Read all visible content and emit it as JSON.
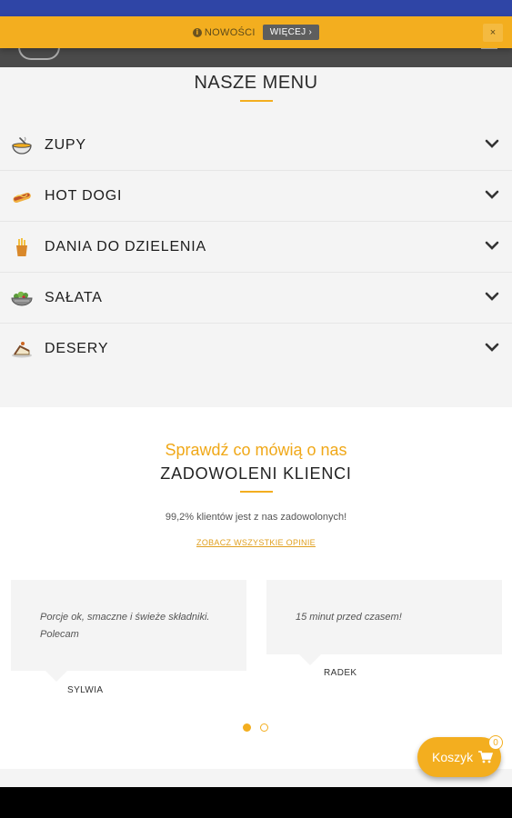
{
  "news_bar": {
    "label": "NOWOŚCI",
    "more_button": "WIĘCEJ ›",
    "close": "×",
    "info_icon_glyph": "i"
  },
  "menu": {
    "title": "NASZE MENU",
    "categories": [
      {
        "label": "ZUPY",
        "icon": "soup-bowl-icon"
      },
      {
        "label": "HOT DOGI",
        "icon": "hot-dog-icon"
      },
      {
        "label": "DANIA DO DZIELENIA",
        "icon": "fries-icon"
      },
      {
        "label": "SAŁATA",
        "icon": "salad-bowl-icon"
      },
      {
        "label": "DESERY",
        "icon": "dessert-icon"
      }
    ]
  },
  "reviews": {
    "subtitle": "Sprawdź co mówią o nas",
    "title": "ZADOWOLENI KLIENCI",
    "stat": "99,2% klientów jest z nas zadowolonych!",
    "link": "ZOBACZ WSZYSTKIE OPINIE",
    "items": [
      {
        "text": "Porcje ok, smaczne i świeże składniki. Polecam",
        "author": "SYLWIA"
      },
      {
        "text": "15 minut przed czasem!",
        "author": "RADEK"
      }
    ],
    "pager_active": 1,
    "pager_count": 2
  },
  "cart": {
    "label": "Koszyk",
    "count": "0"
  },
  "colors": {
    "accent": "#f3ae1f",
    "status_bar": "#2f45a6",
    "header": "#4a4a4a"
  }
}
